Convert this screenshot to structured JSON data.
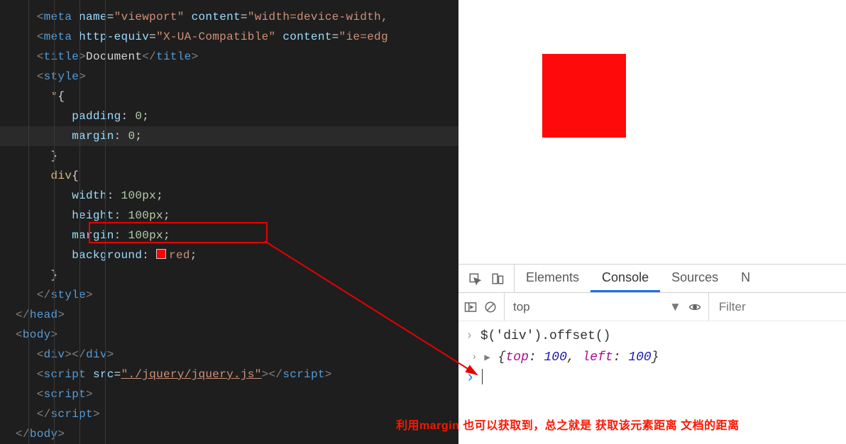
{
  "editor": {
    "meta_viewport": {
      "tag": "meta",
      "attr_name": "name",
      "attr_name_val": "viewport",
      "attr_content": "content",
      "attr_content_val": "width=device-width,"
    },
    "meta_compat": {
      "tag": "meta",
      "attr_he": "http-equiv",
      "attr_he_val": "X-UA-Compatible",
      "attr_content": "content",
      "attr_content_val": "ie=edg"
    },
    "title_open": "title",
    "title_text": "Document",
    "title_close": "title",
    "style_open": "style",
    "style_close": "style",
    "rule_star": "*",
    "brace_open": "{",
    "brace_close": "}",
    "padding_prop": "padding",
    "padding_val": "0",
    "margin_prop": "margin",
    "margin_val": "0",
    "div_rule": "div",
    "width_prop": "width",
    "width_val": "100px",
    "height_prop": "height",
    "height_val": "100px",
    "margin_prop2": "margin",
    "margin_val2": "100px",
    "background_prop": "background",
    "background_val": "red",
    "head_close": "head",
    "body_open": "body",
    "body_close": "body",
    "div_tag": "div",
    "script_tag": "script",
    "script_src_attr": "src",
    "script_src_val": "./jquery/jquery.js"
  },
  "devtools": {
    "tabs": {
      "elements": "Elements",
      "console": "Console",
      "sources": "Sources",
      "more": "N"
    },
    "context_selector": "top",
    "filter_placeholder": "Filter",
    "input_expr": "$('div').offset()",
    "result_key_top": "top",
    "result_val_top": "100",
    "result_key_left": "left",
    "result_val_left": "100"
  },
  "annotation_text": "利用margin  也可以获取到，总之就是 获取该元素距离 文档的距离"
}
